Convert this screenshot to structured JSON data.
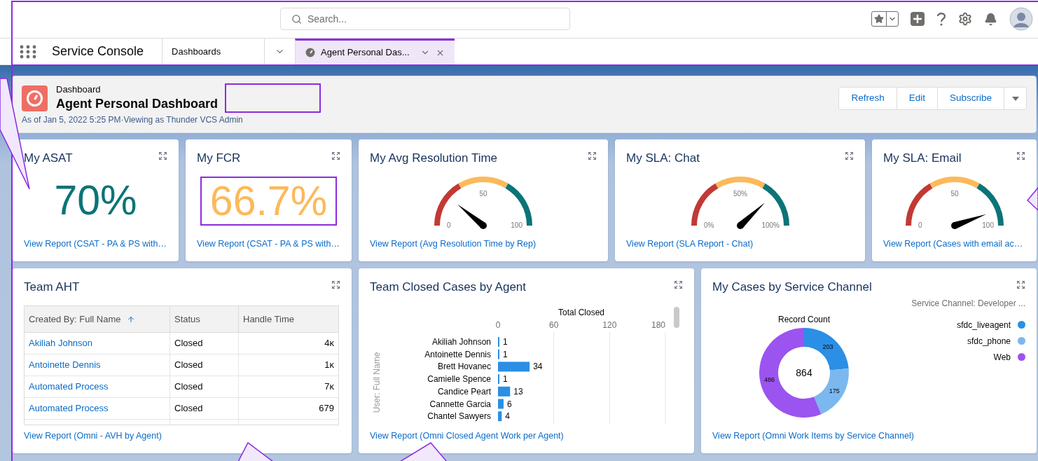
{
  "header": {
    "search": {
      "placeholder": "Search..."
    }
  },
  "nav": {
    "app_name": "Service Console",
    "tabs": [
      {
        "label": "Dashboards",
        "selected": false
      },
      {
        "label": "Agent Personal Das...",
        "selected": true
      }
    ]
  },
  "dashboard": {
    "type_label": "Dashboard",
    "title": "Agent Personal Dashboard",
    "subtitle": "As of Jan 5, 2022 5:25 PM·Viewing as Thunder VCS Admin",
    "actions": [
      "Refresh",
      "Edit",
      "Subscribe"
    ]
  },
  "row_1": [
    {
      "kind": "metric",
      "title": "My ASAT",
      "value": "70%",
      "color": "#0b7477",
      "link": "View Report (CSAT - PA & PS with…"
    },
    {
      "kind": "metric",
      "title": "My FCR",
      "value": "66.7%",
      "color": "#fcb95b",
      "link": "View Report (CSAT - PA & PS with…"
    },
    {
      "kind": "gauge",
      "title": "My Avg Resolution Time",
      "min": "0",
      "mid": "50",
      "max": "100",
      "link": "View Report (Avg Resolution Time by Rep)"
    },
    {
      "kind": "gauge",
      "title": "My SLA: Chat",
      "min": "0%",
      "mid": "50%",
      "max": "100%",
      "link": "View Report (SLA Report - Chat)"
    },
    {
      "kind": "gauge",
      "title": "My SLA: Email",
      "min": "0",
      "mid": "50",
      "max": "100",
      "link": "View Report (Cases with email ac…"
    }
  ],
  "team_aht": {
    "title": "Team AHT",
    "columns": [
      {
        "label": "Created By: Full Name",
        "sorted": true
      },
      {
        "label": "Status",
        "sorted": false
      },
      {
        "label": "Handle Time",
        "sorted": false
      }
    ],
    "rows": [
      [
        "Akiliah Johnson",
        "Closed",
        "4ᴋ"
      ],
      [
        "Antoinette Dennis",
        "Closed",
        "1ᴋ"
      ],
      [
        "Automated Process",
        "Closed",
        "7ᴋ"
      ],
      [
        "Automated Process",
        "Closed",
        "679"
      ]
    ],
    "link": "View Report (Omni - AVH by Agent)"
  },
  "team_closed_cases": {
    "title": "Team Closed Cases by Agent",
    "chart_data": {
      "type": "bar",
      "orientation": "horizontal",
      "title": "Total Closed",
      "ylabel": "User: Full Name",
      "categories": [
        "Akiliah Johnson",
        "Antoinette Dennis",
        "Brett Hovanec",
        "Camielle Spence",
        "Candice Peart",
        "Cannette Garcia",
        "Chantel Sawyers"
      ],
      "values": [
        1,
        1,
        34,
        1,
        13,
        6,
        4
      ],
      "xticks": [
        0,
        60,
        120,
        180
      ],
      "xlim": [
        0,
        180
      ],
      "data_labels": true
    },
    "link": "View Report (Omni Closed Agent Work per Agent)"
  },
  "my_cases_by_channel": {
    "title": "My Cases by Service Channel",
    "chart_data": {
      "type": "donut",
      "legend_title": "Service Channel: Developer ...",
      "categories": [
        "sfdc_liveagent",
        "sfdc_phone",
        "Web"
      ],
      "series": [
        {
          "name": "Record Count",
          "values": [
            203,
            175,
            486
          ]
        }
      ],
      "colors": [
        "#2b8fe6",
        "#7bb8f0",
        "#9b54f0"
      ],
      "data_labels": true
    },
    "center_label": "864",
    "link": "View Report (Omni Work Items by Service Channel)"
  }
}
